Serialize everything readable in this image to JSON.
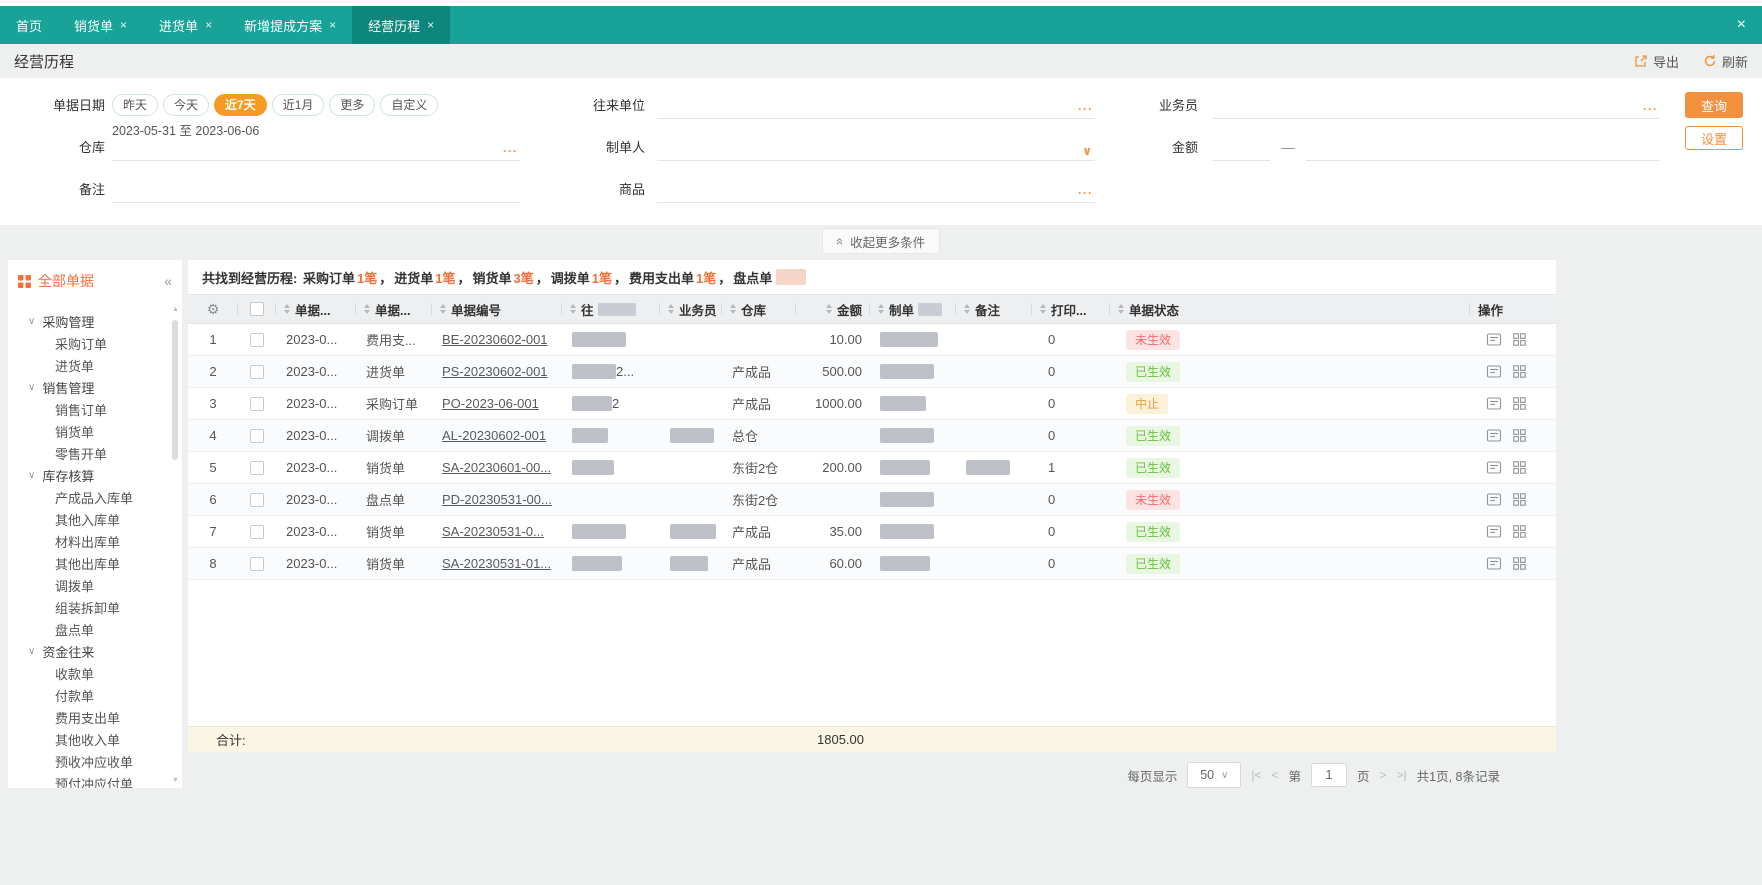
{
  "colors": {
    "teal": "#17a398",
    "teal_active": "#0d877c",
    "orange_button": "#f2913d",
    "orange_pill": "#f59a23",
    "orange_accent": "#f4703b",
    "status_invalid": "#f56c6c",
    "status_valid": "#67c23a",
    "status_stopped": "#e6a23c"
  },
  "icons": {
    "close": "×",
    "dots": "···",
    "chevron_down": "∨",
    "collapse": "«",
    "gear": "⚙",
    "scroll_up": "▲",
    "scroll_down": "▼"
  },
  "topbar": {
    "tabs": [
      {
        "label": "首页",
        "closable": false,
        "active": false
      },
      {
        "label": "销货单",
        "closable": true,
        "active": false
      },
      {
        "label": "进货单",
        "closable": true,
        "active": false
      },
      {
        "label": "新增提成方案",
        "closable": true,
        "active": false
      },
      {
        "label": "经营历程",
        "closable": true,
        "active": true
      }
    ]
  },
  "header": {
    "title": "经营历程",
    "export_label": "导出",
    "refresh_label": "刷新"
  },
  "filters": {
    "date": {
      "label": "单据日期",
      "pills": [
        {
          "label": "昨天",
          "active": false
        },
        {
          "label": "今天",
          "active": false
        },
        {
          "label": "近7天",
          "active": true
        },
        {
          "label": "近1月",
          "active": false
        },
        {
          "label": "更多",
          "active": false
        },
        {
          "label": "自定义",
          "active": false
        }
      ],
      "range": "2023-05-31 至 2023-06-06"
    },
    "partner_label": "往来单位",
    "salesman_label": "业务员",
    "warehouse_label": "仓库",
    "maker_label": "制单人",
    "amount_label": "金额",
    "amount_separator": "—",
    "remark_label": "备注",
    "product_label": "商品",
    "search_label": "查询",
    "settings_label": "设置",
    "collapse_label": "收起更多条件"
  },
  "sidebar": {
    "title": "全部单据",
    "tree": [
      {
        "label": "采购管理",
        "type": "group"
      },
      {
        "label": "采购订单",
        "type": "item"
      },
      {
        "label": "进货单",
        "type": "item"
      },
      {
        "label": "销售管理",
        "type": "group"
      },
      {
        "label": "销售订单",
        "type": "item"
      },
      {
        "label": "销货单",
        "type": "item"
      },
      {
        "label": "零售开单",
        "type": "item"
      },
      {
        "label": "库存核算",
        "type": "group"
      },
      {
        "label": "产成品入库单",
        "type": "item"
      },
      {
        "label": "其他入库单",
        "type": "item"
      },
      {
        "label": "材料出库单",
        "type": "item"
      },
      {
        "label": "其他出库单",
        "type": "item"
      },
      {
        "label": "调拨单",
        "type": "item"
      },
      {
        "label": "组装拆卸单",
        "type": "item"
      },
      {
        "label": "盘点单",
        "type": "item"
      },
      {
        "label": "资金往来",
        "type": "group"
      },
      {
        "label": "收款单",
        "type": "item"
      },
      {
        "label": "付款单",
        "type": "item"
      },
      {
        "label": "费用支出单",
        "type": "item"
      },
      {
        "label": "其他收入单",
        "type": "item"
      },
      {
        "label": "预收冲应收单",
        "type": "item"
      },
      {
        "label": "预付冲应付单",
        "type": "item"
      }
    ]
  },
  "summary": {
    "prefix": "共找到经营历程: ",
    "counts": [
      {
        "name": "采购订单",
        "count": "1笔"
      },
      {
        "name": "进货单",
        "count": "1笔"
      },
      {
        "name": "销货单",
        "count": "3笔"
      },
      {
        "name": "调拨单",
        "count": "1笔"
      },
      {
        "name": "费用支出单",
        "count": "1笔"
      }
    ],
    "separator": "，",
    "last_name": "盘点单",
    "last_count_blurred": true
  },
  "table": {
    "headers": [
      {
        "kind": "gear"
      },
      {
        "kind": "checkbox"
      },
      {
        "label": "单据...",
        "sort": true
      },
      {
        "label": "单据...",
        "sort": true
      },
      {
        "label": "单据编号",
        "sort": true
      },
      {
        "label": "往",
        "sort": true,
        "blur": 38
      },
      {
        "label": "业务员",
        "sort": true
      },
      {
        "label": "仓库",
        "sort": true
      },
      {
        "label": "金额",
        "sort": true,
        "align": "right"
      },
      {
        "label": "制单",
        "sort": true,
        "blur": 24
      },
      {
        "label": "备注",
        "sort": true
      },
      {
        "label": "打印...",
        "sort": true
      },
      {
        "label": "单据状态",
        "sort": true
      },
      {
        "label": "操作"
      }
    ],
    "rows": [
      {
        "no": "1",
        "date": "2023-0...",
        "type": "费用支...",
        "doc": "BE-20230602-001",
        "partner_blur": 54,
        "partner_text": "",
        "salesman_blur": 0,
        "warehouse": "",
        "amount": "10.00",
        "maker_blur": 58,
        "remark_blur": 0,
        "print": "0",
        "status": "未生效",
        "status_kind": "invalid"
      },
      {
        "no": "2",
        "date": "2023-0...",
        "type": "进货单",
        "doc": "PS-20230602-001",
        "partner_blur": 44,
        "partner_text": "2...",
        "salesman_blur": 0,
        "warehouse": "产成品",
        "amount": "500.00",
        "maker_blur": 54,
        "remark_blur": 0,
        "print": "0",
        "status": "已生效",
        "status_kind": "valid"
      },
      {
        "no": "3",
        "date": "2023-0...",
        "type": "采购订单",
        "doc": "PO-2023-06-001",
        "partner_blur": 40,
        "partner_text": "2",
        "salesman_blur": 0,
        "warehouse": "产成品",
        "amount": "1000.00",
        "maker_blur": 46,
        "remark_blur": 0,
        "print": "0",
        "status": "中止",
        "status_kind": "stopped"
      },
      {
        "no": "4",
        "date": "2023-0...",
        "type": "调拨单",
        "doc": "AL-20230602-001",
        "partner_blur": 36,
        "partner_text": "",
        "salesman_blur": 44,
        "warehouse": "总仓",
        "amount": "",
        "maker_blur": 54,
        "remark_blur": 0,
        "print": "0",
        "status": "已生效",
        "status_kind": "valid"
      },
      {
        "no": "5",
        "date": "2023-0...",
        "type": "销货单",
        "doc": "SA-20230601-00...",
        "partner_blur": 42,
        "partner_text": "",
        "salesman_blur": 0,
        "warehouse": "东街2仓",
        "amount": "200.00",
        "maker_blur": 50,
        "remark_blur": 44,
        "print": "1",
        "status": "已生效",
        "status_kind": "valid"
      },
      {
        "no": "6",
        "date": "2023-0...",
        "type": "盘点单",
        "doc": "PD-20230531-00...",
        "partner_blur": 0,
        "partner_text": "",
        "salesman_blur": 0,
        "warehouse": "东街2仓",
        "amount": "",
        "maker_blur": 54,
        "remark_blur": 0,
        "print": "0",
        "status": "未生效",
        "status_kind": "invalid"
      },
      {
        "no": "7",
        "date": "2023-0...",
        "type": "销货单",
        "doc": "SA-20230531-0...",
        "partner_blur": 54,
        "partner_text": "",
        "salesman_blur": 46,
        "warehouse": "产成品",
        "amount": "35.00",
        "maker_blur": 54,
        "remark_blur": 0,
        "print": "0",
        "status": "已生效",
        "status_kind": "valid"
      },
      {
        "no": "8",
        "date": "2023-0...",
        "type": "销货单",
        "doc": "SA-20230531-01...",
        "partner_blur": 50,
        "partner_text": "",
        "salesman_blur": 38,
        "warehouse": "产成品",
        "amount": "60.00",
        "maker_blur": 50,
        "remark_blur": 0,
        "print": "0",
        "status": "已生效",
        "status_kind": "valid"
      }
    ],
    "total_label": "合计:",
    "total_value": "1805.00"
  },
  "pagination": {
    "per_page_label": "每页显示",
    "per_page_value": "50",
    "first": "|<",
    "prev": "<",
    "page_prefix": "第",
    "page_value": "1",
    "page_suffix": "页",
    "next": ">",
    "last": ">|",
    "info": "共1页, 8条记录"
  }
}
